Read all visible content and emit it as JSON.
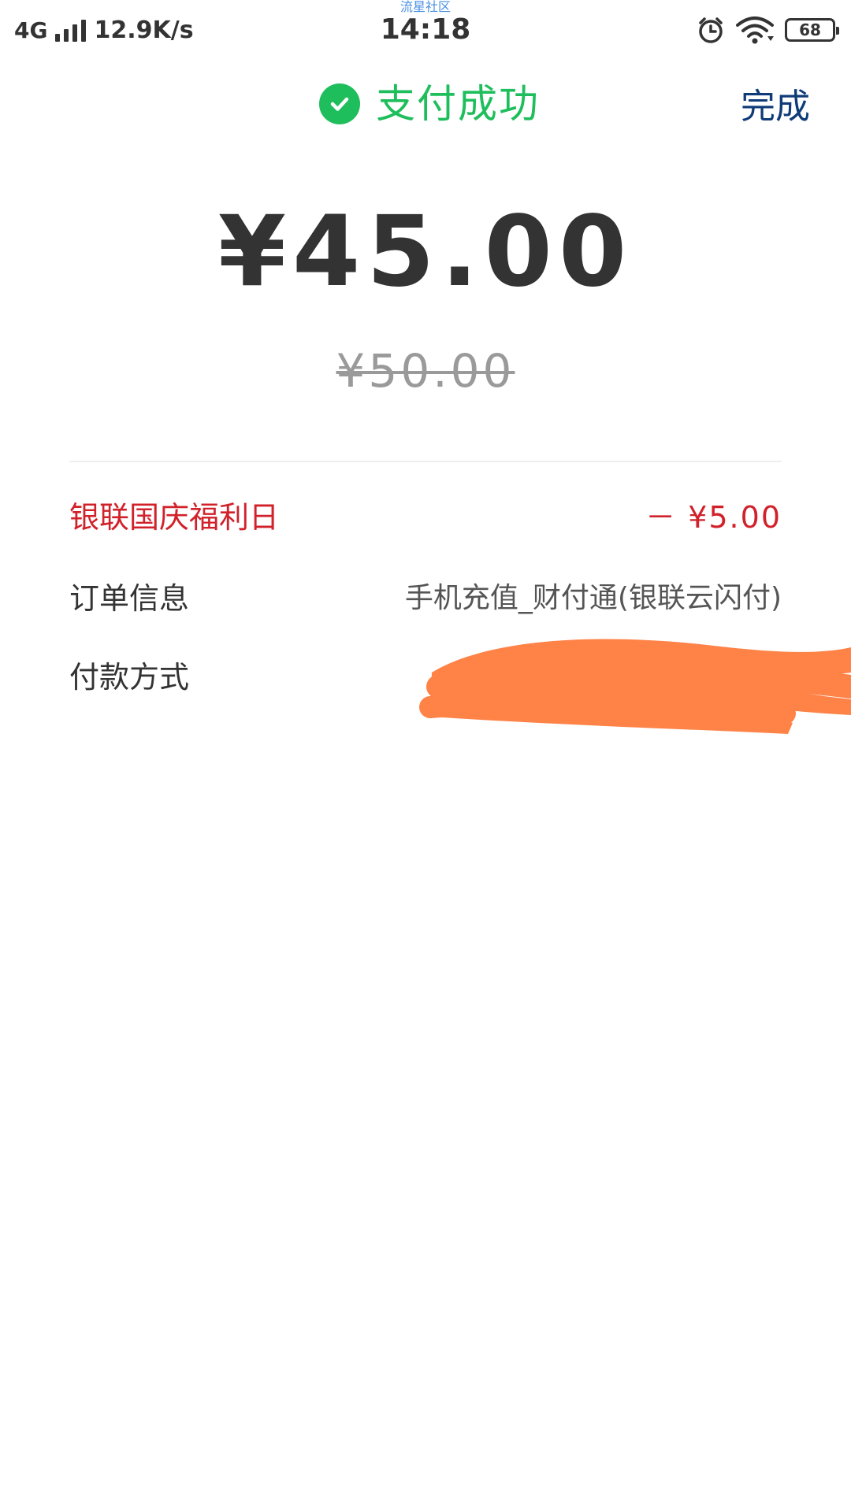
{
  "status_bar": {
    "watermark": "流星社区",
    "network": "4G",
    "speed": "12.9K/s",
    "time": "14:18",
    "battery": "68"
  },
  "header": {
    "title": "支付成功",
    "done_label": "完成"
  },
  "payment": {
    "amount": "¥45.00",
    "original_amount": "¥50.00"
  },
  "rows": [
    {
      "label": "银联国庆福利日",
      "value": "－ ¥5.00"
    },
    {
      "label": "订单信息",
      "value": "手机充值_财付通(银联云闪付)"
    },
    {
      "label": "付款方式",
      "value": ""
    }
  ],
  "colors": {
    "success": "#1fbe5c",
    "accent": "#0f3c78",
    "promo": "#d1212a",
    "redaction": "#ff8247"
  }
}
